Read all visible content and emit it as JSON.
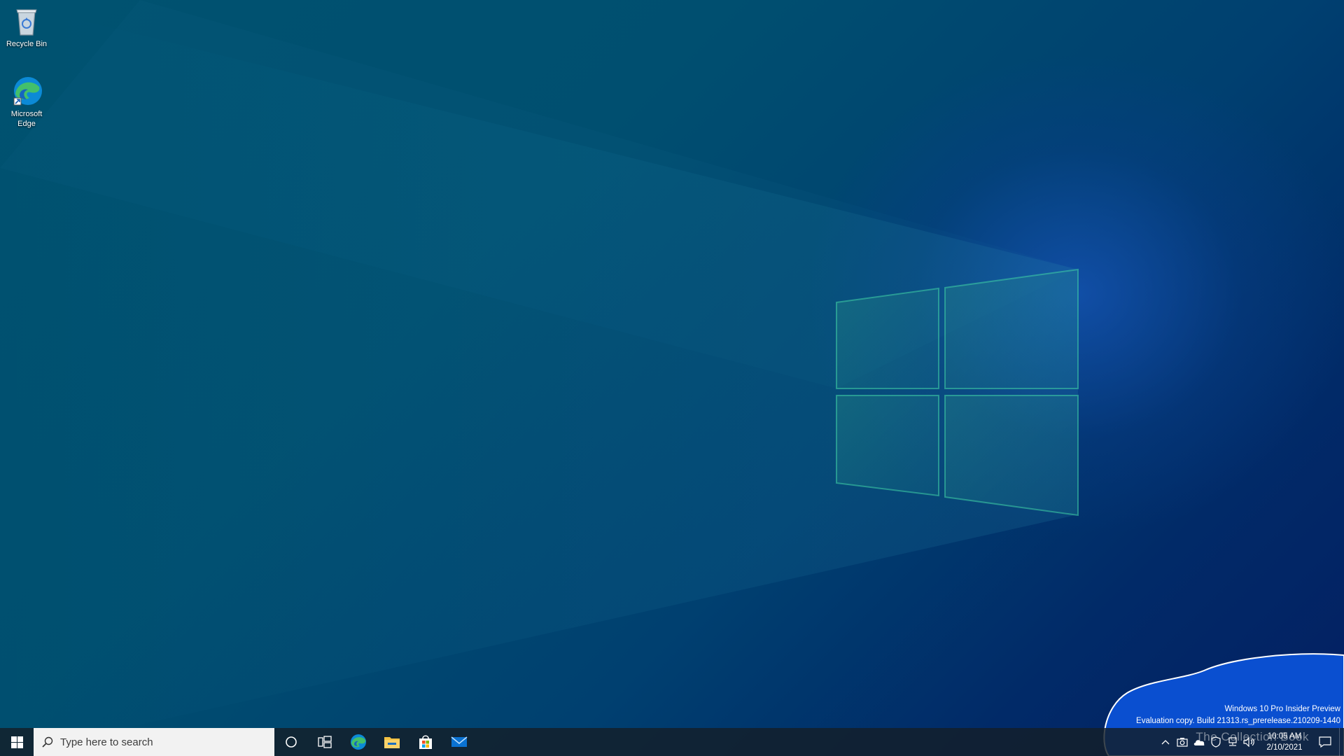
{
  "desktop": {
    "icons": [
      {
        "label": "Recycle Bin",
        "icon": "recycle-bin-icon"
      },
      {
        "label": "Microsoft Edge",
        "icon": "edge-icon"
      }
    ]
  },
  "watermark": {
    "line1": "Windows 10 Pro Insider Preview",
    "line2": "Evaluation copy. Build 21313.rs_prerelease.210209-1440",
    "overlay": "The Collection Book"
  },
  "taskbar": {
    "search_placeholder": "Type here to search",
    "pinned": [
      "cortana-icon",
      "task-view-icon",
      "edge-icon",
      "file-explorer-icon",
      "store-icon",
      "mail-icon"
    ],
    "tray": {
      "time": "10:05 AM",
      "date": "2/10/2021"
    }
  },
  "colors": {
    "accent": "#0a5fd6",
    "taskbar": "#14202a",
    "search_bg": "#f2f2f2"
  }
}
